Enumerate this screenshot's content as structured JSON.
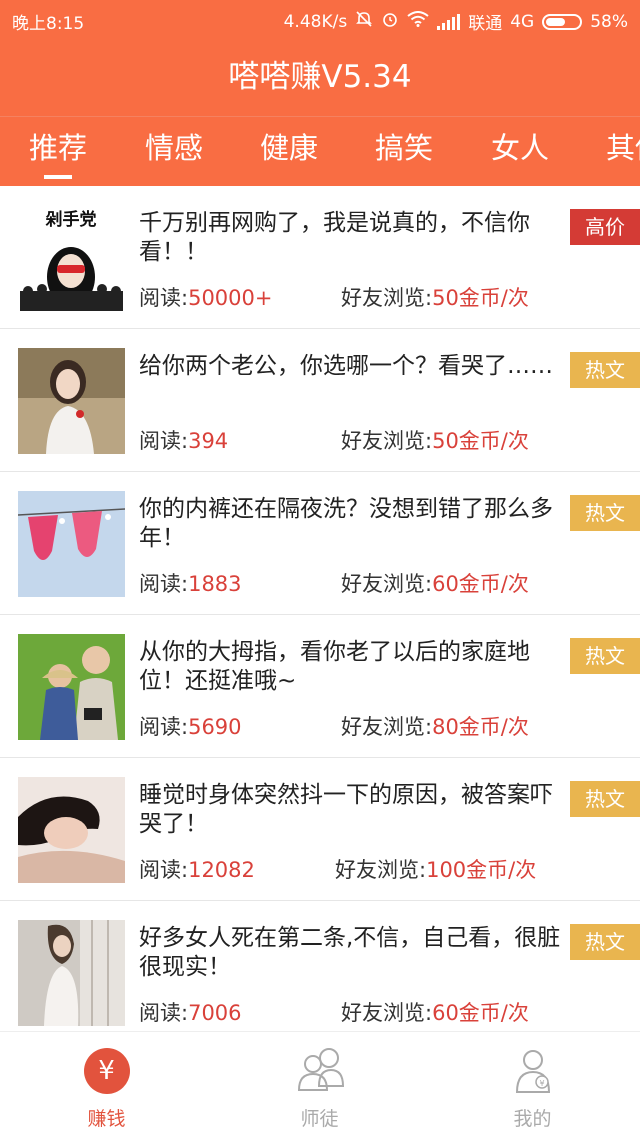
{
  "status_bar": {
    "time": "晚上8:15",
    "speed": "4.48K/s",
    "carrier": "联通",
    "network": "4G",
    "battery": "58%",
    "battery_level": 0.58
  },
  "header": {
    "title": "嗒嗒赚V5.34"
  },
  "tabs": [
    {
      "label": "推荐",
      "active": true
    },
    {
      "label": "情感"
    },
    {
      "label": "健康"
    },
    {
      "label": "搞笑"
    },
    {
      "label": "女人"
    },
    {
      "label": "其他"
    }
  ],
  "articles": [
    {
      "title": "千万别再网购了，我是说真的，不信你看！！",
      "reads_label": "阅读:",
      "reads": "50000+",
      "friend_label": "好友浏览:",
      "reward": "50金币/次",
      "badge": "高价",
      "badge_type": "high",
      "thumb_text": "剁手党"
    },
    {
      "title": "给你两个老公，你选哪一个？看哭了……",
      "reads_label": "阅读:",
      "reads": "394",
      "friend_label": "好友浏览:",
      "reward": "50金币/次",
      "badge": "热文",
      "badge_type": "hot"
    },
    {
      "title": "你的内裤还在隔夜洗？没想到错了那么多年！",
      "reads_label": "阅读:",
      "reads": "1883",
      "friend_label": "好友浏览:",
      "reward": "60金币/次",
      "badge": "热文",
      "badge_type": "hot"
    },
    {
      "title": "从你的大拇指，看你老了以后的家庭地位！还挺准哦~",
      "reads_label": "阅读:",
      "reads": "5690",
      "friend_label": "好友浏览:",
      "reward": "80金币/次",
      "badge": "热文",
      "badge_type": "hot"
    },
    {
      "title": "睡觉时身体突然抖一下的原因，被答案吓哭了！",
      "reads_label": "阅读:",
      "reads": "12082",
      "friend_label": "好友浏览:",
      "reward": "100金币/次",
      "badge": "热文",
      "badge_type": "hot"
    },
    {
      "title": "好多女人死在第二条,不信，自己看，很脏很现实！",
      "reads_label": "阅读:",
      "reads": "7006",
      "friend_label": "好友浏览:",
      "reward": "60金币/次",
      "badge": "热文",
      "badge_type": "hot"
    }
  ],
  "bottom_nav": [
    {
      "label": "赚钱",
      "icon": "yuan-icon",
      "symbol": "¥",
      "active": true
    },
    {
      "label": "师徒",
      "icon": "people-icon"
    },
    {
      "label": "我的",
      "icon": "user-icon"
    }
  ],
  "colors": {
    "brand": "#f96d43",
    "hot_badge": "#e9b54f",
    "high_badge": "#d43b35",
    "accent_red": "#d9413a"
  }
}
